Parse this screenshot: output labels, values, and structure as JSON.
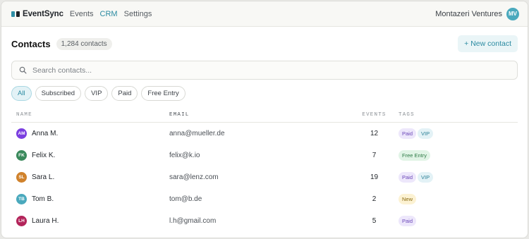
{
  "nav": {
    "brand": "EventSync",
    "links": [
      "Events",
      "CRM",
      "Settings"
    ],
    "active_link": "CRM",
    "org": "Montazeri Ventures",
    "org_initials": "MV"
  },
  "header": {
    "title": "Contacts",
    "count": "1,284 contacts",
    "new_button": "+ New contact"
  },
  "search": {
    "placeholder": "Search contacts...",
    "icon": "search-icon"
  },
  "filters": [
    "All",
    "Subscribed",
    "VIP",
    "Paid",
    "Free Entry"
  ],
  "active_filter": "All",
  "table": {
    "columns": [
      "NAME",
      "EMAIL",
      "EVENTS",
      "TAGS"
    ],
    "rows": [
      {
        "initials": "AM",
        "name": "Anna M.",
        "email": "anna@mueller.de",
        "events": "12",
        "tags": [
          "Paid",
          "VIP"
        ],
        "color": "#7b3fe0"
      },
      {
        "initials": "FK",
        "name": "Felix K.",
        "email": "felix@k.io",
        "events": "7",
        "tags": [
          "Free Entry"
        ],
        "color": "#3a8a5c"
      },
      {
        "initials": "SL",
        "name": "Sara L.",
        "email": "sara@lenz.com",
        "events": "19",
        "tags": [
          "Paid",
          "VIP"
        ],
        "color": "#d0822c"
      },
      {
        "initials": "TB",
        "name": "Tom B.",
        "email": "tom@b.de",
        "events": "2",
        "tags": [
          "New"
        ],
        "color": "#4aa9bd"
      },
      {
        "initials": "LH",
        "name": "Laura H.",
        "email": "l.h@gmail.com",
        "events": "5",
        "tags": [
          "Paid"
        ],
        "color": "#b3245a"
      }
    ]
  },
  "tag_colors": {
    "Paid": {
      "bg": "#ede7fb",
      "fg": "#6b47b8"
    },
    "VIP": {
      "bg": "#e3f2f6",
      "fg": "#2a7f95"
    },
    "Free Entry": {
      "bg": "#e1f4e6",
      "fg": "#2d7a45"
    },
    "New": {
      "bg": "#fcf2d3",
      "fg": "#8a6a10"
    }
  },
  "accent": "#2a8aa1"
}
